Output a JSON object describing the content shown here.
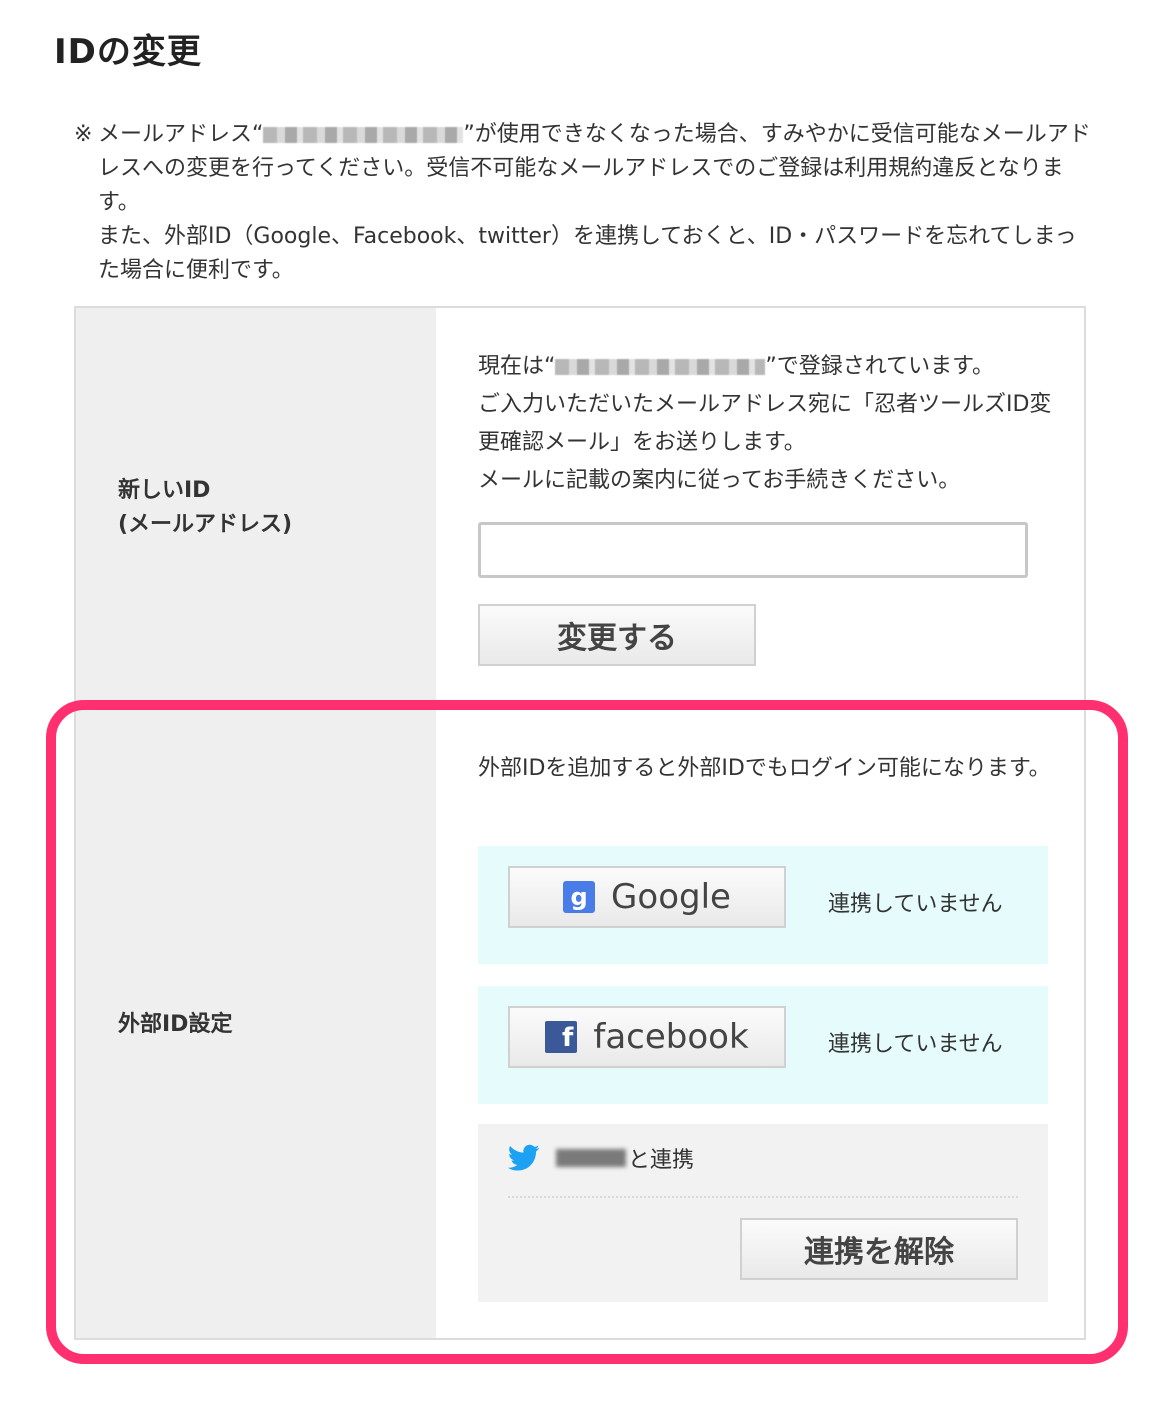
{
  "page_title": "IDの変更",
  "notice": {
    "mark": "※",
    "line1_a": "メールアドレス“",
    "line1_b": "”が使用できなくなった場合、すみやかに受信可能なメールアドレスへの変更を行ってください。受信不可能なメールアドレスでのご登録は利用規約違反となります。",
    "line2": "また、外部ID（Google、Facebook、twitter）を連携しておくと、ID・パスワードを忘れてしまった場合に便利です。"
  },
  "new_id": {
    "label_line1": "新しいID",
    "label_line2": "(メールアドレス)",
    "current_a": "現在は“",
    "current_b": "”で登録されています。",
    "desc1": "ご入力いただいたメールアドレス宛に「忍者ツールズID変更確認メール」をお送りします。",
    "desc2": "メールに記載の案内に従ってお手続きください。",
    "email_value": "",
    "submit_label": "変更する"
  },
  "external_id": {
    "label": "外部ID設定",
    "desc": "外部IDを追加すると外部IDでもログイン可能になります。",
    "google": {
      "icon_text": "g",
      "button_label": "Google",
      "status": "連携していません"
    },
    "facebook": {
      "icon_text": "f",
      "button_label": "facebook",
      "status": "連携していません"
    },
    "twitter": {
      "linked_suffix": "と連携",
      "unlink_label": "連携を解除"
    }
  },
  "colors": {
    "highlight": "#ff2f70",
    "sns_bg": "#e6fcfc",
    "google_blue": "#4a7ce8",
    "facebook_blue": "#3b5998",
    "twitter_blue": "#1da1f2"
  }
}
